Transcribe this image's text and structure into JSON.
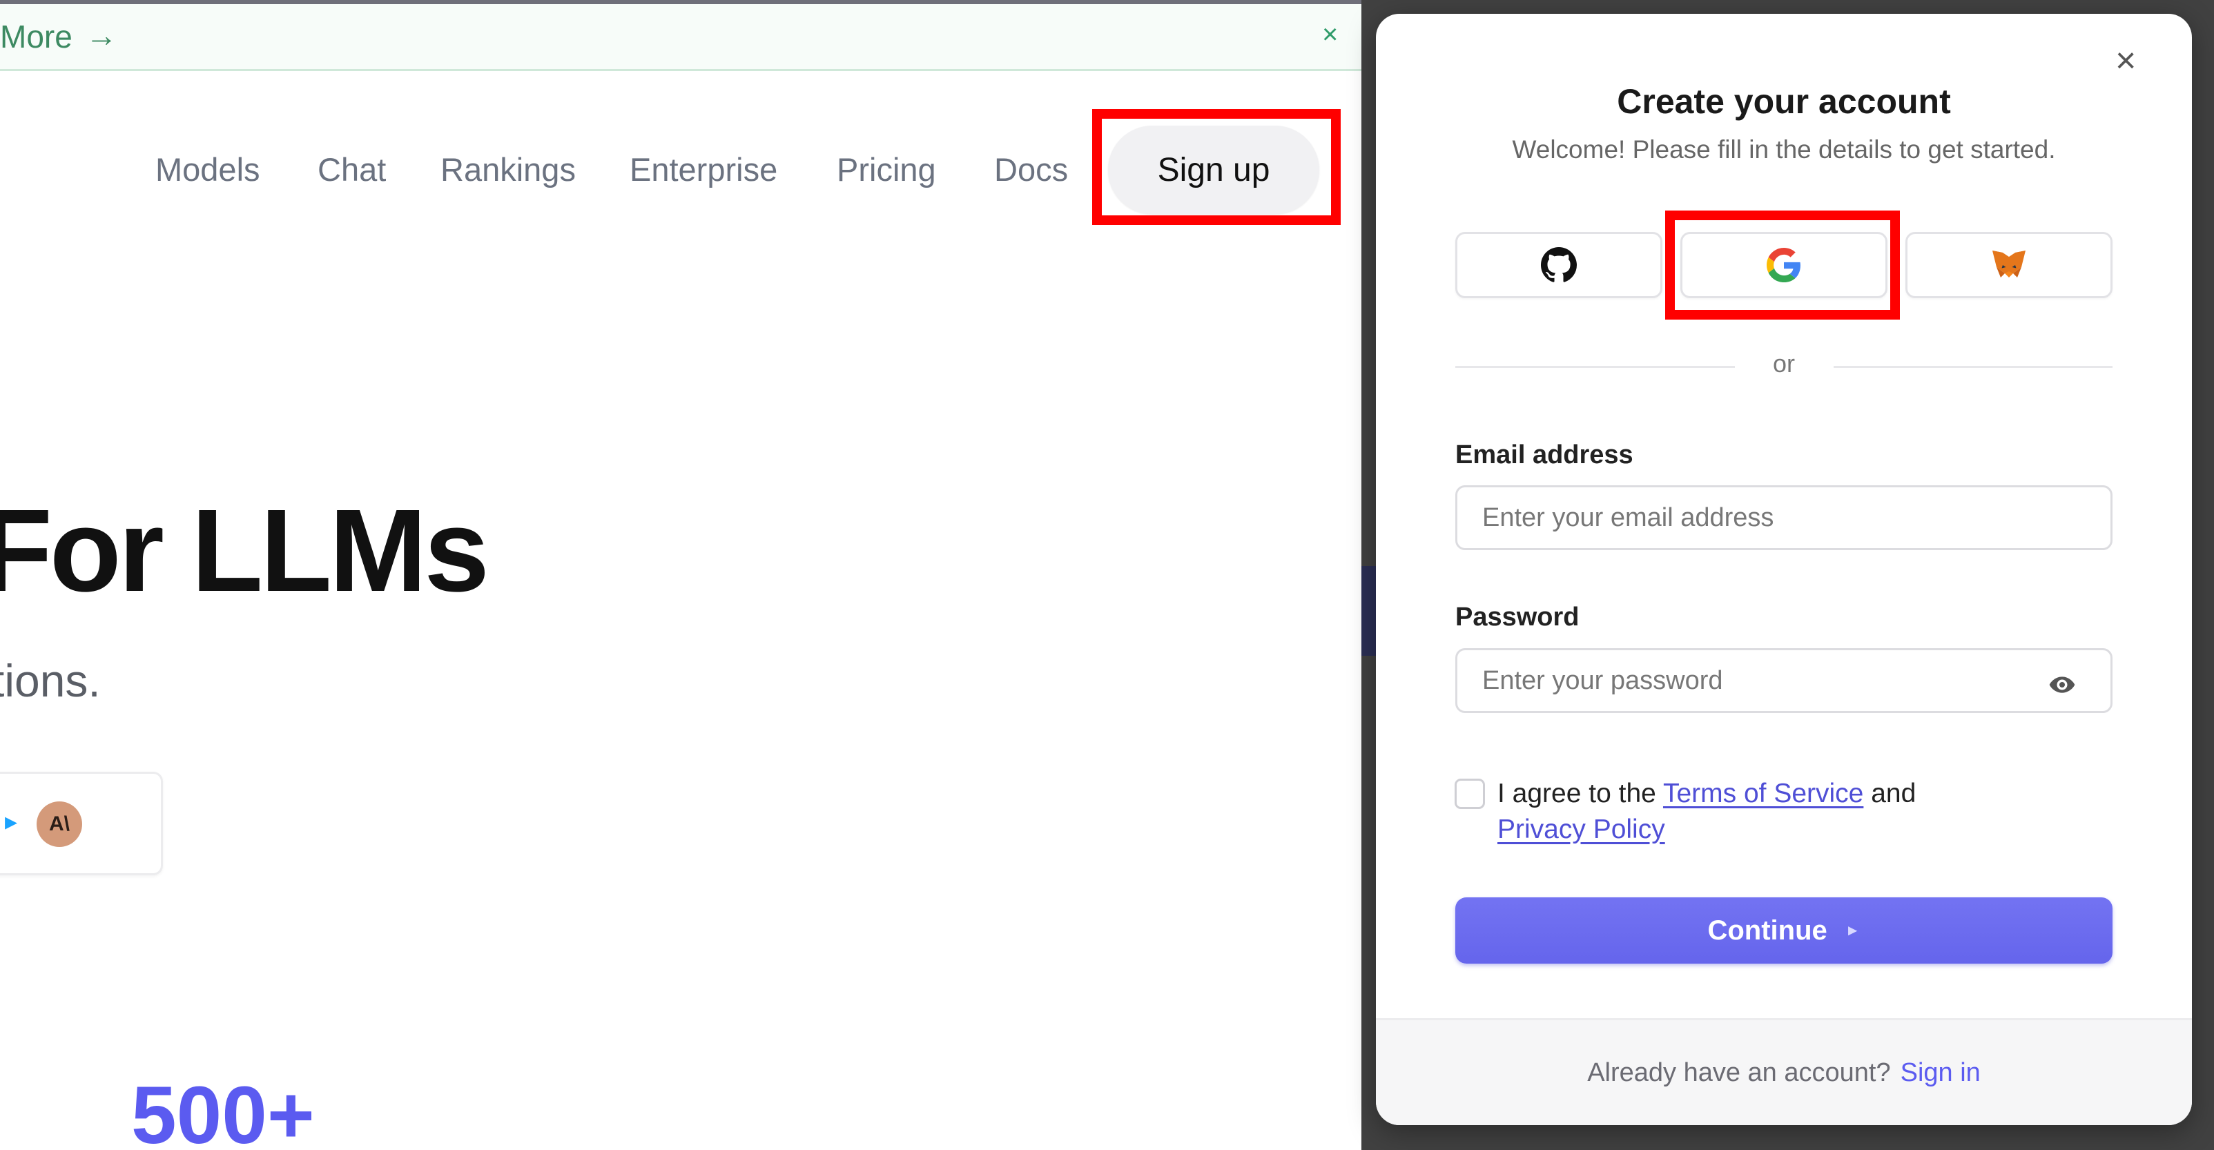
{
  "banner": {
    "more_label": "More",
    "arrow": "→",
    "close": "×"
  },
  "nav": {
    "items": [
      "Models",
      "Chat",
      "Rankings",
      "Enterprise",
      "Pricing",
      "Docs"
    ],
    "signup_label": "Sign up"
  },
  "hero": {
    "title": "For LLMs",
    "subtitle": "tions.",
    "card_logo": "A\\",
    "stat": "500+"
  },
  "modal": {
    "title": "Create your account",
    "subtitle": "Welcome! Please fill in the details to get started.",
    "close": "×",
    "social": [
      "github-icon",
      "google-icon",
      "metamask-icon"
    ],
    "divider": "or",
    "email_label": "Email address",
    "email_placeholder": "Enter your email address",
    "password_label": "Password",
    "password_placeholder": "Enter your password",
    "terms": {
      "prefix": "I agree to the ",
      "tos": "Terms of Service",
      "and": " and",
      "privacy": "Privacy Policy"
    },
    "continue_label": "Continue",
    "continue_arrow": "►",
    "footer_text": "Already have an account?",
    "footer_link": "Sign in"
  },
  "colors": {
    "accent": "#6a6aef",
    "link": "#4f4fd6",
    "highlight": "#ff0000",
    "overlay": "#414141"
  }
}
